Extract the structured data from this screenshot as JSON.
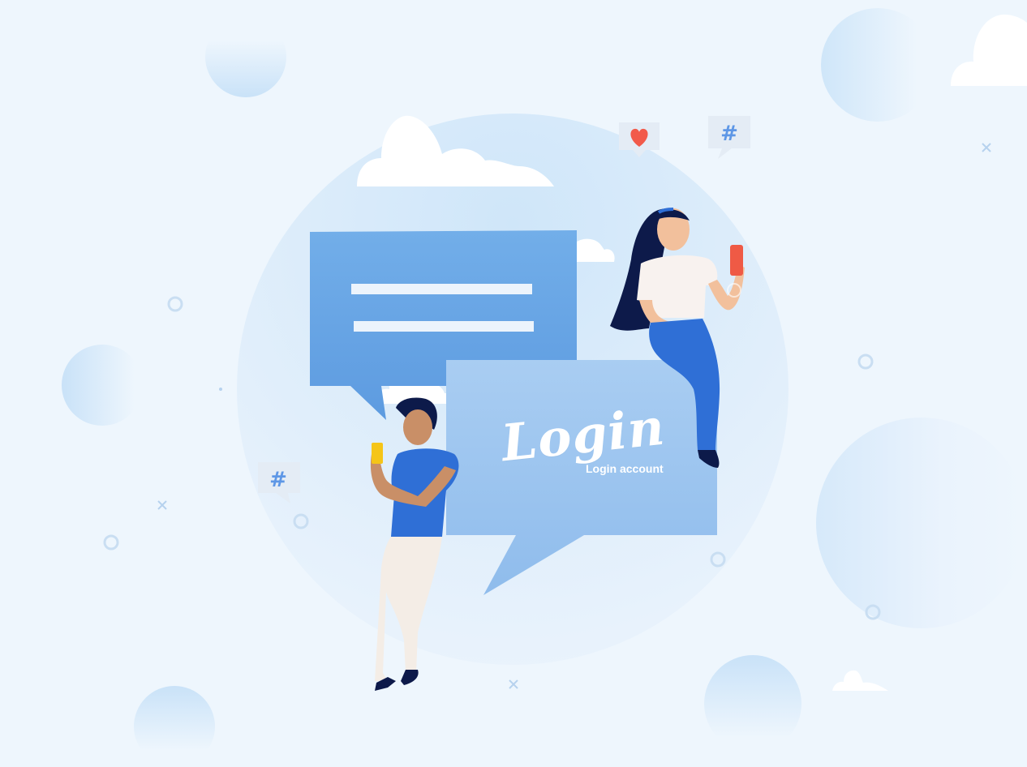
{
  "illustration": {
    "login_title": "Login",
    "login_subtitle": "Login account",
    "left_bubble_icon": "#",
    "top_right_bubble_icon": "#",
    "heart_bubble_icon": "heart-icon"
  },
  "colors": {
    "background": "#eef6fd",
    "bubble_dark": "#6aa6e6",
    "bubble_light": "#a6cbf1",
    "shirt_blue": "#2f6fd6",
    "hair_navy": "#0e1a4a",
    "phone_red": "#ef5a45",
    "phone_yellow": "#f5c518",
    "heart_red": "#f25a4a"
  }
}
